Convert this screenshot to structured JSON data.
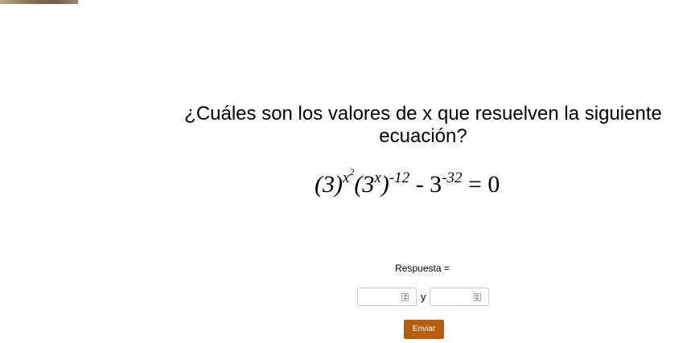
{
  "question": {
    "line1": "¿Cuáles son los valores de x que resuelven la siguiente",
    "line2": "ecuación?"
  },
  "equation": {
    "base1": "(3)",
    "exp1_base": "x",
    "exp1_sup": "2",
    "base2": "(3",
    "exp2": "x",
    "close2": ")",
    "exp3": "-12",
    "minus": " - 3",
    "exp4": "-32",
    "equals": " = 0"
  },
  "answer": {
    "label": "Respuesta =",
    "input1_value": "",
    "connector": "y",
    "input2_value": ""
  },
  "submit": {
    "label": "Enviar",
    "color": "#b55e12"
  }
}
